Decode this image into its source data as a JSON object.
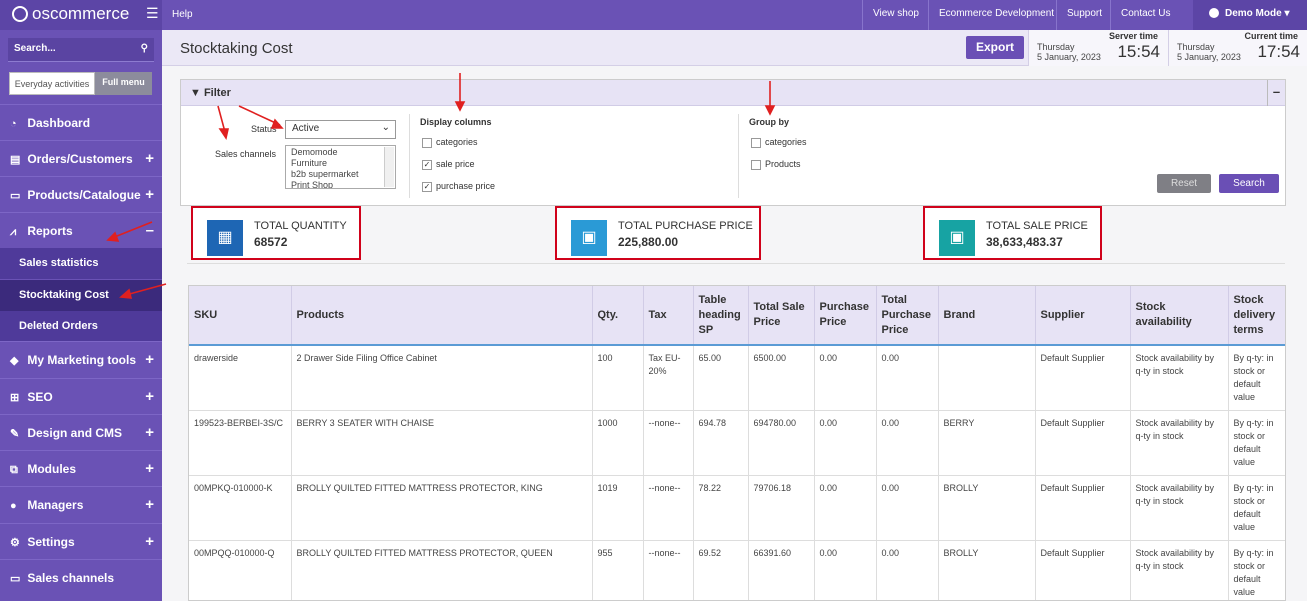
{
  "brand": {
    "name": "oscommerce"
  },
  "topbar": {
    "help": "Help",
    "links": [
      "View shop",
      "Ecommerce Development",
      "Support",
      "Contact Us"
    ],
    "user": "Demo Mode ▾"
  },
  "sidebar": {
    "search_placeholder": "Search...",
    "tabs": [
      "Everyday activities",
      "Full menu"
    ],
    "items": [
      {
        "label": "Dashboard",
        "icon": "dashboard-icon"
      },
      {
        "label": "Orders/Customers",
        "icon": "orders-icon"
      },
      {
        "label": "Products/Catalogue",
        "icon": "folder-icon"
      },
      {
        "label": "Reports",
        "icon": "chart-icon"
      },
      {
        "label": "My Marketing tools",
        "icon": "tag-icon"
      },
      {
        "label": "SEO",
        "icon": "sitemap-icon"
      },
      {
        "label": "Design and CMS",
        "icon": "brush-icon"
      },
      {
        "label": "Modules",
        "icon": "modules-icon"
      },
      {
        "label": "Managers",
        "icon": "user-icon"
      },
      {
        "label": "Settings",
        "icon": "gear-icon"
      },
      {
        "label": "Sales channels",
        "icon": "monitor-icon"
      }
    ],
    "report_sub": [
      "Sales statistics",
      "Stocktaking Cost",
      "Deleted Orders"
    ]
  },
  "header": {
    "title": "Stocktaking Cost",
    "export": "Export",
    "server_time": {
      "label": "Server time",
      "day": "Thursday",
      "date": "5 January, 2023",
      "time": "15:54"
    },
    "current_time": {
      "label": "Current time",
      "day": "Thursday",
      "date": "5 January, 2023",
      "time": "17:54"
    }
  },
  "filter": {
    "title": "Filter",
    "status_label": "Status",
    "status_value": "Active",
    "channels_label": "Sales channels",
    "channels": [
      "Demomode",
      "Furniture",
      "b2b supermarket",
      "Print Shop"
    ],
    "display_label": "Display columns",
    "display_options": [
      {
        "label": "categories",
        "checked": false
      },
      {
        "label": "sale price",
        "checked": true
      },
      {
        "label": "purchase price",
        "checked": true
      }
    ],
    "group_label": "Group by",
    "group_options": [
      {
        "label": "categories",
        "checked": false
      },
      {
        "label": "Products",
        "checked": false
      }
    ],
    "reset": "Reset",
    "search": "Search"
  },
  "summary": [
    {
      "label": "TOTAL QUANTITY",
      "value": "68572",
      "icon": "boxes-icon",
      "color": "#1e66b4"
    },
    {
      "label": "TOTAL PURCHASE PRICE",
      "value": "225,880.00",
      "icon": "money-icon",
      "color": "#2a9ad6"
    },
    {
      "label": "TOTAL SALE PRICE",
      "value": "38,633,483.37",
      "icon": "money-icon",
      "color": "#17a3a3"
    }
  ],
  "table": {
    "headers": [
      "SKU",
      "Products",
      "Qty.",
      "Tax",
      "Table heading SP",
      "Total Sale Price",
      "Purchase Price",
      "Total Purchase Price",
      "Brand",
      "Supplier",
      "Stock availability",
      "Stock delivery terms"
    ],
    "rows": [
      [
        "drawerside",
        "2 Drawer Side Filing Office Cabinet",
        "100",
        "Tax EU-20%",
        "65.00",
        "6500.00",
        "0.00",
        "0.00",
        "",
        "Default Supplier",
        "Stock availability by q-ty in stock",
        "By q-ty: in stock or default value"
      ],
      [
        "199523-BERBEI-3S/C",
        "BERRY 3 SEATER WITH CHAISE",
        "1000",
        "--none--",
        "694.78",
        "694780.00",
        "0.00",
        "0.00",
        "BERRY",
        "Default Supplier",
        "Stock availability by q-ty in stock",
        "By q-ty: in stock or default value"
      ],
      [
        "00MPKQ-010000-K",
        "BROLLY QUILTED FITTED MATTRESS PROTECTOR, KING",
        "1019",
        "--none--",
        "78.22",
        "79706.18",
        "0.00",
        "0.00",
        "BROLLY",
        "Default Supplier",
        "Stock availability by q-ty in stock",
        "By q-ty: in stock or default value"
      ],
      [
        "00MPQQ-010000-Q",
        "BROLLY QUILTED FITTED MATTRESS PROTECTOR, QUEEN",
        "955",
        "--none--",
        "69.52",
        "66391.60",
        "0.00",
        "0.00",
        "BROLLY",
        "Default Supplier",
        "Stock availability by q-ty in stock",
        "By q-ty: in stock or default value"
      ]
    ]
  }
}
